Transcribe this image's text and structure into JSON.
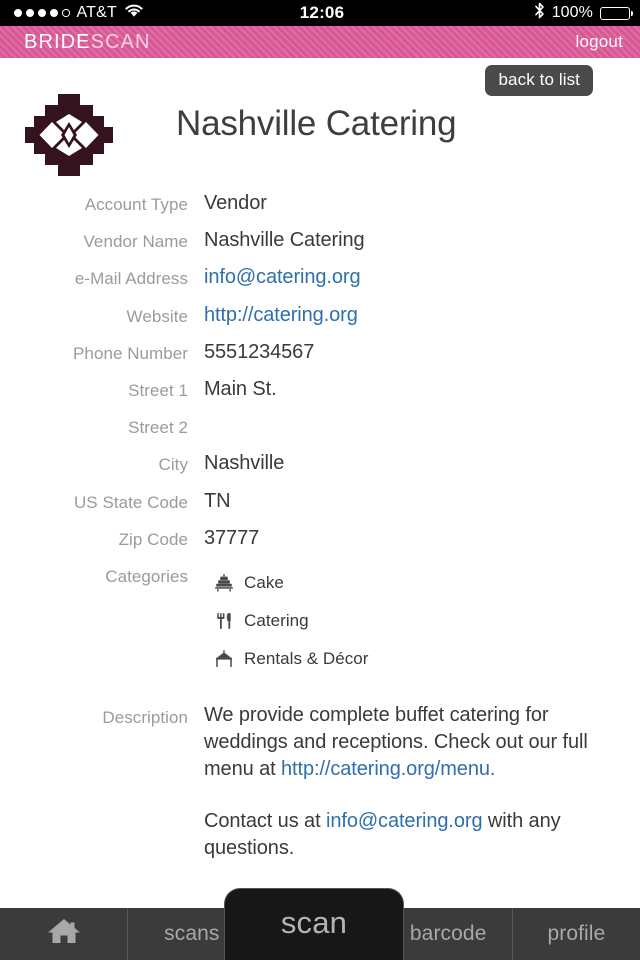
{
  "status_bar": {
    "carrier": "AT&T",
    "signal_dots_filled": 4,
    "signal_dots_total": 5,
    "wifi_icon": "wifi-icon",
    "time": "12:06",
    "bluetooth_icon": "bluetooth-icon",
    "battery_percent": "100%",
    "battery_level": 100
  },
  "app_bar": {
    "brand_part1": "BRIDE",
    "brand_part2": "SCAN",
    "logout_label": "logout",
    "background_color": "#e05c9a"
  },
  "toolbar": {
    "back_label": "back to list"
  },
  "header": {
    "logo_icon": "bridescan-cross-logo",
    "logo_color": "#34131f",
    "title": "Nashville Catering"
  },
  "detail_fields": [
    {
      "label": "Account Type",
      "value": "Vendor",
      "is_link": false
    },
    {
      "label": "Vendor Name",
      "value": "Nashville Catering",
      "is_link": false
    },
    {
      "label": "e-Mail Address",
      "value": "info@catering.org",
      "is_link": true
    },
    {
      "label": "Website",
      "value": "http://catering.org",
      "is_link": true
    },
    {
      "label": "Phone Number",
      "value": "5551234567",
      "is_link": false
    },
    {
      "label": "Street 1",
      "value": "Main St.",
      "is_link": false
    },
    {
      "label": "Street 2",
      "value": "",
      "is_link": false
    },
    {
      "label": "City",
      "value": "Nashville",
      "is_link": false
    },
    {
      "label": "US State Code",
      "value": "TN",
      "is_link": false
    },
    {
      "label": "Zip Code",
      "value": "37777",
      "is_link": false
    }
  ],
  "categories": {
    "label": "Categories",
    "items": [
      {
        "name": "Cake",
        "icon": "cake-icon"
      },
      {
        "name": "Catering",
        "icon": "fork-knife-icon"
      },
      {
        "name": "Rentals & Décor",
        "icon": "tent-canopy-icon"
      }
    ]
  },
  "description": {
    "label": "Description",
    "paragraph1_text_before": "We provide complete buffet catering for weddings and receptions. Check out our full menu at ",
    "paragraph1_link": "http://catering.org/menu.",
    "paragraph2_text_before": "Contact us at ",
    "paragraph2_link": "info@catering.org",
    "paragraph2_text_after": " with any questions."
  },
  "tab_bar": {
    "home_icon": "home-icon",
    "scans_label": "scans",
    "scan_label": "scan",
    "barcode_label": "barcode",
    "profile_label": "profile"
  },
  "colors": {
    "accent_pink": "#e05c9a",
    "link_blue": "#2f6fad",
    "label_grey": "#9b9b9b",
    "value_dark": "#3a3a3a",
    "tabbar_grey": "#3b3b3b"
  }
}
